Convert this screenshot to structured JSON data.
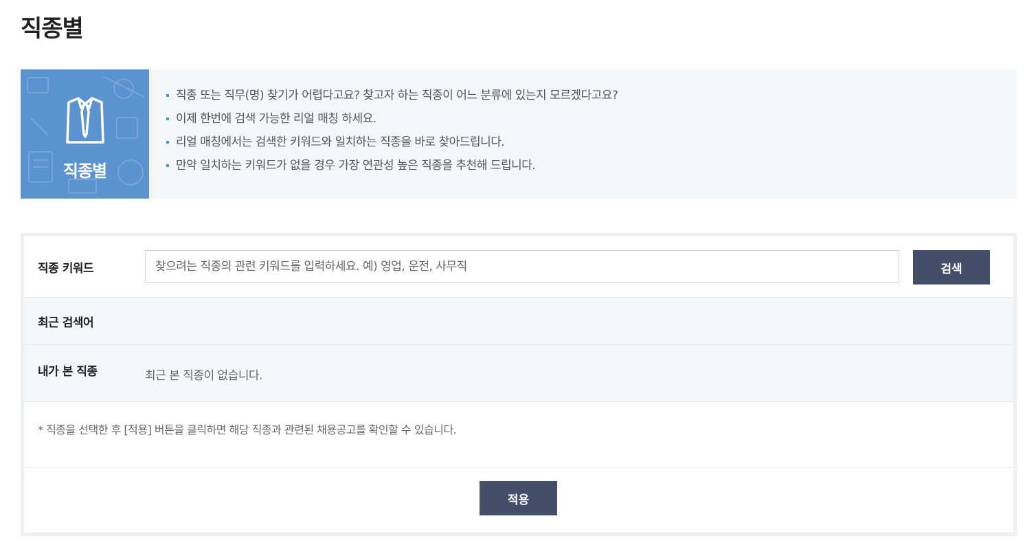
{
  "page": {
    "title": "직종별"
  },
  "banner": {
    "icon": "shirt-tie-icon",
    "icon_label": "직종별",
    "accent_color": "#5b93d0",
    "bullet_color": "#3a9bd5",
    "items": [
      "직종 또는 직무(명) 찾기가 어렵다고요? 찾고자 하는 직종이 어느 분류에 있는지 모르겠다고요?",
      "이제 한번에 검색 가능한 리얼 매칭 하세요.",
      "리얼 매칭에서는 검색한 키워드와 일치하는 직종을 바로 찾아드립니다.",
      "만약 일치하는 키워드가 없을 경우 가장 연관성 높은 직종을 추천해 드립니다."
    ]
  },
  "search": {
    "label": "직종 키워드",
    "value": "",
    "placeholder": "찾으려는 직종의 관련 키워드를 입력하세요. 예) 영업, 운전, 사무직",
    "button_label": "검색",
    "button_color": "#434f68"
  },
  "recent": {
    "label": "최근 검색어"
  },
  "viewed": {
    "label": "내가 본 직종",
    "empty_text": "최근 본 직종이 없습니다."
  },
  "notice": "* 직종을 선택한 후 [적용] 버튼을 클릭하면 해당 직종과 관련된 채용공고를 확인할 수 있습니다.",
  "apply": {
    "label": "적용"
  }
}
